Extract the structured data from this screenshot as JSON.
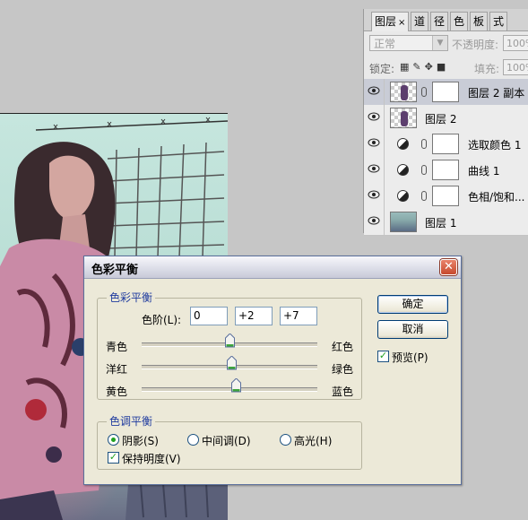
{
  "panel": {
    "tabs": [
      {
        "label": "图层",
        "close": "×"
      },
      {
        "label": "道"
      },
      {
        "label": "径"
      },
      {
        "label": "色"
      },
      {
        "label": "板"
      },
      {
        "label": "式"
      }
    ],
    "blend_mode": "正常",
    "opacity_label": "不透明度:",
    "opacity_value": "100%",
    "lock_label": "锁定:",
    "fill_label": "填充:",
    "fill_value": "100%",
    "layers": [
      {
        "name": "图层 2 副本",
        "type": "pixel",
        "selected": true
      },
      {
        "name": "图层 2",
        "type": "pixel",
        "selected": false
      },
      {
        "name": "选取颜色 1",
        "type": "adjustment",
        "selected": false
      },
      {
        "name": "曲线 1",
        "type": "adjustment",
        "selected": false
      },
      {
        "name": "色相/饱和...",
        "type": "adjustment",
        "selected": false
      },
      {
        "name": "图层 1",
        "type": "photo",
        "selected": false
      }
    ]
  },
  "dialog": {
    "title": "色彩平衡",
    "close_glyph": "✕",
    "color_balance_group": "色彩平衡",
    "levels_label": "色阶(L):",
    "levels": [
      "0",
      "+2",
      "+7"
    ],
    "sliders": [
      {
        "left": "青色",
        "right": "红色",
        "value": 0
      },
      {
        "left": "洋红",
        "right": "绿色",
        "value": 2
      },
      {
        "left": "黄色",
        "right": "蓝色",
        "value": 7
      }
    ],
    "tone_group": "色调平衡",
    "tones": [
      {
        "label": "阴影(S)",
        "selected": true
      },
      {
        "label": "中间调(D)",
        "selected": false
      },
      {
        "label": "高光(H)",
        "selected": false
      }
    ],
    "preserve_luminosity": "保持明度(V)",
    "preserve_checked": true,
    "ok_label": "确定",
    "cancel_label": "取消",
    "preview_label": "预览(P)",
    "preview_checked": true,
    "check_glyph": "✓"
  }
}
